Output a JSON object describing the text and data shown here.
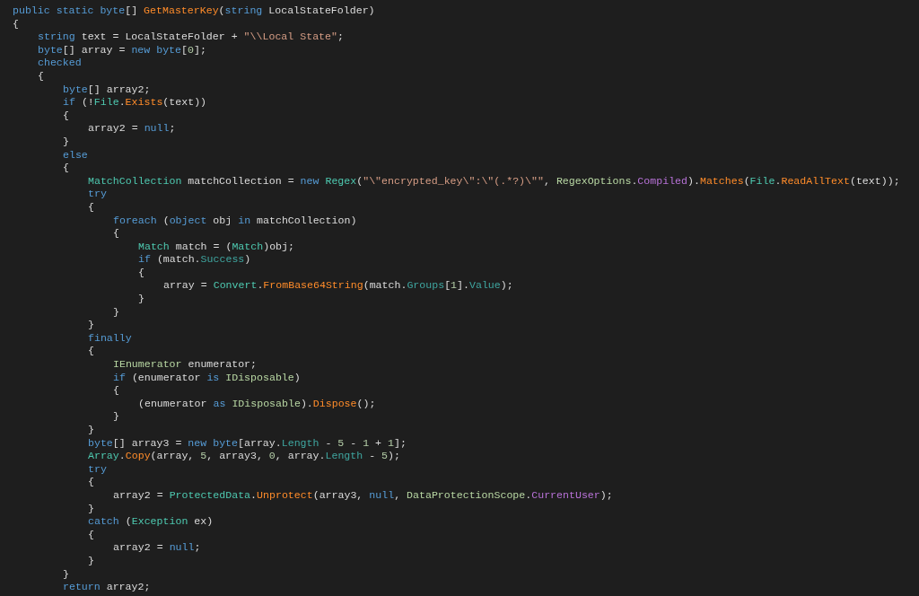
{
  "editor": {
    "lines": [
      {
        "spans": [
          {
            "kind": "kw",
            "text": "public static byte"
          },
          {
            "kind": "id",
            "text": "[] "
          },
          {
            "kind": "m",
            "text": "GetMasterKey"
          },
          {
            "kind": "id",
            "text": "("
          },
          {
            "kind": "kw",
            "text": "string"
          },
          {
            "kind": "id",
            "text": " LocalStateFolder)"
          }
        ]
      },
      {
        "spans": [
          {
            "kind": "id",
            "text": "{"
          }
        ],
        "children": [
          {
            "spans": [
              {
                "kind": "kw",
                "text": "string"
              },
              {
                "kind": "id",
                "text": " text = LocalStateFolder + "
              },
              {
                "kind": "s",
                "text": "\"\\\\Local State\""
              },
              {
                "kind": "id",
                "text": ";"
              }
            ]
          },
          {
            "spans": [
              {
                "kind": "kw",
                "text": "byte"
              },
              {
                "kind": "id",
                "text": "[] array = "
              },
              {
                "kind": "kw",
                "text": "new byte"
              },
              {
                "kind": "id",
                "text": "["
              },
              {
                "kind": "n",
                "text": "0"
              },
              {
                "kind": "id",
                "text": "];"
              }
            ]
          },
          {
            "spans": [
              {
                "kind": "kw",
                "text": "checked"
              }
            ]
          },
          {
            "spans": [
              {
                "kind": "id",
                "text": "{"
              }
            ],
            "children": [
              {
                "spans": [
                  {
                    "kind": "kw",
                    "text": "byte"
                  },
                  {
                    "kind": "id",
                    "text": "[] array2;"
                  }
                ]
              },
              {
                "spans": [
                  {
                    "kind": "kw",
                    "text": "if"
                  },
                  {
                    "kind": "id",
                    "text": " (!"
                  },
                  {
                    "kind": "ty",
                    "text": "File"
                  },
                  {
                    "kind": "id",
                    "text": "."
                  },
                  {
                    "kind": "m",
                    "text": "Exists"
                  },
                  {
                    "kind": "id",
                    "text": "(text))"
                  }
                ]
              },
              {
                "spans": [
                  {
                    "kind": "id",
                    "text": "{"
                  }
                ],
                "children": [
                  {
                    "spans": [
                      {
                        "kind": "id",
                        "text": "array2 = "
                      },
                      {
                        "kind": "kw",
                        "text": "null"
                      },
                      {
                        "kind": "id",
                        "text": ";"
                      }
                    ]
                  }
                ]
              },
              {
                "spans": [
                  {
                    "kind": "id",
                    "text": "}"
                  }
                ]
              },
              {
                "spans": [
                  {
                    "kind": "kw",
                    "text": "else"
                  }
                ]
              },
              {
                "spans": [
                  {
                    "kind": "id",
                    "text": "{"
                  }
                ],
                "children": [
                  {
                    "spans": [
                      {
                        "kind": "ty",
                        "text": "MatchCollection"
                      },
                      {
                        "kind": "id",
                        "text": " matchCollection = "
                      },
                      {
                        "kind": "kw",
                        "text": "new "
                      },
                      {
                        "kind": "ty",
                        "text": "Regex"
                      },
                      {
                        "kind": "id",
                        "text": "("
                      },
                      {
                        "kind": "s",
                        "text": "\"\\\"encrypted_key\\\":\\\"(.*?)\\\"\""
                      },
                      {
                        "kind": "id",
                        "text": ", "
                      },
                      {
                        "kind": "st",
                        "text": "RegexOptions"
                      },
                      {
                        "kind": "id",
                        "text": "."
                      },
                      {
                        "kind": "e",
                        "text": "Compiled"
                      },
                      {
                        "kind": "id",
                        "text": ")."
                      },
                      {
                        "kind": "m",
                        "text": "Matches"
                      },
                      {
                        "kind": "id",
                        "text": "("
                      },
                      {
                        "kind": "ty",
                        "text": "File"
                      },
                      {
                        "kind": "id",
                        "text": "."
                      },
                      {
                        "kind": "m",
                        "text": "ReadAllText"
                      },
                      {
                        "kind": "id",
                        "text": "(text));"
                      }
                    ]
                  },
                  {
                    "spans": [
                      {
                        "kind": "kw",
                        "text": "try"
                      }
                    ]
                  },
                  {
                    "spans": [
                      {
                        "kind": "id",
                        "text": "{"
                      }
                    ],
                    "children": [
                      {
                        "spans": [
                          {
                            "kind": "kw",
                            "text": "foreach"
                          },
                          {
                            "kind": "id",
                            "text": " ("
                          },
                          {
                            "kind": "kw",
                            "text": "object"
                          },
                          {
                            "kind": "id",
                            "text": " obj "
                          },
                          {
                            "kind": "kw",
                            "text": "in"
                          },
                          {
                            "kind": "id",
                            "text": " matchCollection)"
                          }
                        ]
                      },
                      {
                        "spans": [
                          {
                            "kind": "id",
                            "text": "{"
                          }
                        ],
                        "children": [
                          {
                            "spans": [
                              {
                                "kind": "ty",
                                "text": "Match"
                              },
                              {
                                "kind": "id",
                                "text": " match = ("
                              },
                              {
                                "kind": "ty",
                                "text": "Match"
                              },
                              {
                                "kind": "id",
                                "text": ")obj;"
                              }
                            ]
                          },
                          {
                            "spans": [
                              {
                                "kind": "kw",
                                "text": "if"
                              },
                              {
                                "kind": "id",
                                "text": " (match."
                              },
                              {
                                "kind": "p",
                                "text": "Success"
                              },
                              {
                                "kind": "id",
                                "text": ")"
                              }
                            ]
                          },
                          {
                            "spans": [
                              {
                                "kind": "id",
                                "text": "{"
                              }
                            ],
                            "children": [
                              {
                                "spans": [
                                  {
                                    "kind": "id",
                                    "text": "array = "
                                  },
                                  {
                                    "kind": "ty",
                                    "text": "Convert"
                                  },
                                  {
                                    "kind": "id",
                                    "text": "."
                                  },
                                  {
                                    "kind": "m",
                                    "text": "FromBase64String"
                                  },
                                  {
                                    "kind": "id",
                                    "text": "(match."
                                  },
                                  {
                                    "kind": "p",
                                    "text": "Groups"
                                  },
                                  {
                                    "kind": "id",
                                    "text": "["
                                  },
                                  {
                                    "kind": "n",
                                    "text": "1"
                                  },
                                  {
                                    "kind": "id",
                                    "text": "]."
                                  },
                                  {
                                    "kind": "p",
                                    "text": "Value"
                                  },
                                  {
                                    "kind": "id",
                                    "text": ");"
                                  }
                                ]
                              }
                            ]
                          },
                          {
                            "spans": [
                              {
                                "kind": "id",
                                "text": "}"
                              }
                            ]
                          }
                        ]
                      },
                      {
                        "spans": [
                          {
                            "kind": "id",
                            "text": "}"
                          }
                        ]
                      }
                    ]
                  },
                  {
                    "spans": [
                      {
                        "kind": "id",
                        "text": "}"
                      }
                    ]
                  },
                  {
                    "spans": [
                      {
                        "kind": "kw",
                        "text": "finally"
                      }
                    ]
                  },
                  {
                    "spans": [
                      {
                        "kind": "id",
                        "text": "{"
                      }
                    ],
                    "children": [
                      {
                        "spans": [
                          {
                            "kind": "st",
                            "text": "IEnumerator"
                          },
                          {
                            "kind": "id",
                            "text": " enumerator;"
                          }
                        ]
                      },
                      {
                        "spans": [
                          {
                            "kind": "kw",
                            "text": "if"
                          },
                          {
                            "kind": "id",
                            "text": " (enumerator "
                          },
                          {
                            "kind": "kw",
                            "text": "is "
                          },
                          {
                            "kind": "st",
                            "text": "IDisposable"
                          },
                          {
                            "kind": "id",
                            "text": ")"
                          }
                        ]
                      },
                      {
                        "spans": [
                          {
                            "kind": "id",
                            "text": "{"
                          }
                        ],
                        "children": [
                          {
                            "spans": [
                              {
                                "kind": "id",
                                "text": "(enumerator "
                              },
                              {
                                "kind": "kw",
                                "text": "as "
                              },
                              {
                                "kind": "st",
                                "text": "IDisposable"
                              },
                              {
                                "kind": "id",
                                "text": ")."
                              },
                              {
                                "kind": "m",
                                "text": "Dispose"
                              },
                              {
                                "kind": "id",
                                "text": "();"
                              }
                            ]
                          }
                        ]
                      },
                      {
                        "spans": [
                          {
                            "kind": "id",
                            "text": "}"
                          }
                        ]
                      }
                    ]
                  },
                  {
                    "spans": [
                      {
                        "kind": "id",
                        "text": "}"
                      }
                    ]
                  },
                  {
                    "spans": [
                      {
                        "kind": "kw",
                        "text": "byte"
                      },
                      {
                        "kind": "id",
                        "text": "[] array3 = "
                      },
                      {
                        "kind": "kw",
                        "text": "new byte"
                      },
                      {
                        "kind": "id",
                        "text": "[array."
                      },
                      {
                        "kind": "p",
                        "text": "Length"
                      },
                      {
                        "kind": "id",
                        "text": " - "
                      },
                      {
                        "kind": "n",
                        "text": "5"
                      },
                      {
                        "kind": "id",
                        "text": " - "
                      },
                      {
                        "kind": "n",
                        "text": "1"
                      },
                      {
                        "kind": "id",
                        "text": " + "
                      },
                      {
                        "kind": "n",
                        "text": "1"
                      },
                      {
                        "kind": "id",
                        "text": "];"
                      }
                    ]
                  },
                  {
                    "spans": [
                      {
                        "kind": "ty",
                        "text": "Array"
                      },
                      {
                        "kind": "id",
                        "text": "."
                      },
                      {
                        "kind": "m",
                        "text": "Copy"
                      },
                      {
                        "kind": "id",
                        "text": "(array, "
                      },
                      {
                        "kind": "n",
                        "text": "5"
                      },
                      {
                        "kind": "id",
                        "text": ", array3, "
                      },
                      {
                        "kind": "n",
                        "text": "0"
                      },
                      {
                        "kind": "id",
                        "text": ", array."
                      },
                      {
                        "kind": "p",
                        "text": "Length"
                      },
                      {
                        "kind": "id",
                        "text": " - "
                      },
                      {
                        "kind": "n",
                        "text": "5"
                      },
                      {
                        "kind": "id",
                        "text": ");"
                      }
                    ]
                  },
                  {
                    "spans": [
                      {
                        "kind": "kw",
                        "text": "try"
                      }
                    ]
                  },
                  {
                    "spans": [
                      {
                        "kind": "id",
                        "text": "{"
                      }
                    ],
                    "children": [
                      {
                        "spans": [
                          {
                            "kind": "id",
                            "text": "array2 = "
                          },
                          {
                            "kind": "ty",
                            "text": "ProtectedData"
                          },
                          {
                            "kind": "id",
                            "text": "."
                          },
                          {
                            "kind": "m",
                            "text": "Unprotect"
                          },
                          {
                            "kind": "id",
                            "text": "(array3, "
                          },
                          {
                            "kind": "kw",
                            "text": "null"
                          },
                          {
                            "kind": "id",
                            "text": ", "
                          },
                          {
                            "kind": "st",
                            "text": "DataProtectionScope"
                          },
                          {
                            "kind": "id",
                            "text": "."
                          },
                          {
                            "kind": "e",
                            "text": "CurrentUser"
                          },
                          {
                            "kind": "id",
                            "text": ");"
                          }
                        ]
                      }
                    ]
                  },
                  {
                    "spans": [
                      {
                        "kind": "id",
                        "text": "}"
                      }
                    ]
                  },
                  {
                    "spans": [
                      {
                        "kind": "kw",
                        "text": "catch"
                      },
                      {
                        "kind": "id",
                        "text": " ("
                      },
                      {
                        "kind": "ty",
                        "text": "Exception"
                      },
                      {
                        "kind": "id",
                        "text": " ex)"
                      }
                    ]
                  },
                  {
                    "spans": [
                      {
                        "kind": "id",
                        "text": "{"
                      }
                    ],
                    "children": [
                      {
                        "spans": [
                          {
                            "kind": "id",
                            "text": "array2 = "
                          },
                          {
                            "kind": "kw",
                            "text": "null"
                          },
                          {
                            "kind": "id",
                            "text": ";"
                          }
                        ]
                      }
                    ]
                  },
                  {
                    "spans": [
                      {
                        "kind": "id",
                        "text": "}"
                      }
                    ]
                  }
                ]
              },
              {
                "spans": [
                  {
                    "kind": "id",
                    "text": "}"
                  }
                ]
              },
              {
                "spans": [
                  {
                    "kind": "kw",
                    "text": "return"
                  },
                  {
                    "kind": "id",
                    "text": " array2;"
                  }
                ]
              }
            ]
          }
        ]
      }
    ]
  }
}
